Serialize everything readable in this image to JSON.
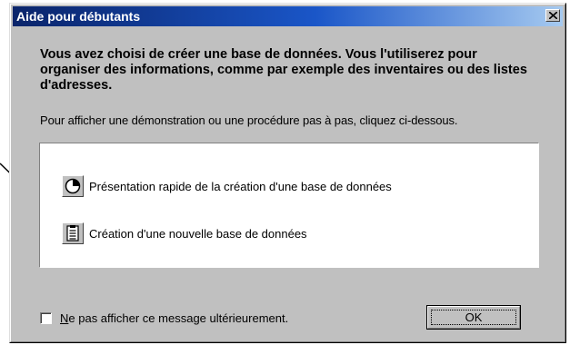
{
  "window": {
    "title": "Aide pour débutants",
    "close_icon": "close-icon"
  },
  "intro": {
    "text": "Vous avez choisi de créer une base de données. Vous l'utiliserez pour organiser des informations, comme par exemple des inventaires ou des listes d'adresses."
  },
  "instruction": {
    "text": "Pour afficher une démonstration ou une procédure pas à pas, cliquez ci-dessous."
  },
  "options": [
    {
      "label": "Présentation rapide de la création d'une base de données",
      "icon": "clock-icon"
    },
    {
      "label": "Création d'une nouvelle base de données",
      "icon": "document-list-icon"
    }
  ],
  "footer": {
    "checkbox_mnemonic": "N",
    "checkbox_rest": "e pas afficher ce message ultérieurement.",
    "checkbox_checked": false,
    "ok_label": "OK"
  },
  "colors": {
    "dialog_face": "#c0c0c0",
    "title_start": "#0a246a",
    "title_end": "#a6caf0",
    "panel": "#ffffff"
  }
}
